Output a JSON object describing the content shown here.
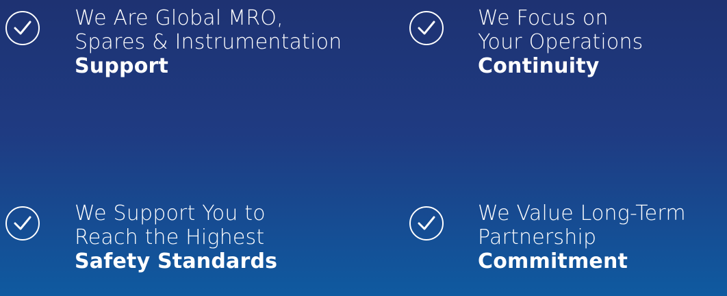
{
  "features": [
    {
      "line1": "We Are Global MRO,",
      "line2": "Spares & Instrumentation",
      "strong": "Support",
      "icon": "check-circle-icon"
    },
    {
      "line1": "We Focus on",
      "line2": "Your Operations",
      "strong": "Continuity",
      "icon": "check-circle-icon"
    },
    {
      "line1": "We Support You to",
      "line2": "Reach the Highest",
      "strong": "Safety Standards",
      "icon": "check-circle-icon"
    },
    {
      "line1": "We Value Long-Term",
      "line2": "Partnership",
      "strong": "Commitment",
      "icon": "check-circle-icon"
    }
  ],
  "colors": {
    "background_top": "#1e3272",
    "background_bottom": "#0f5aa0",
    "text": "#ffffff"
  }
}
